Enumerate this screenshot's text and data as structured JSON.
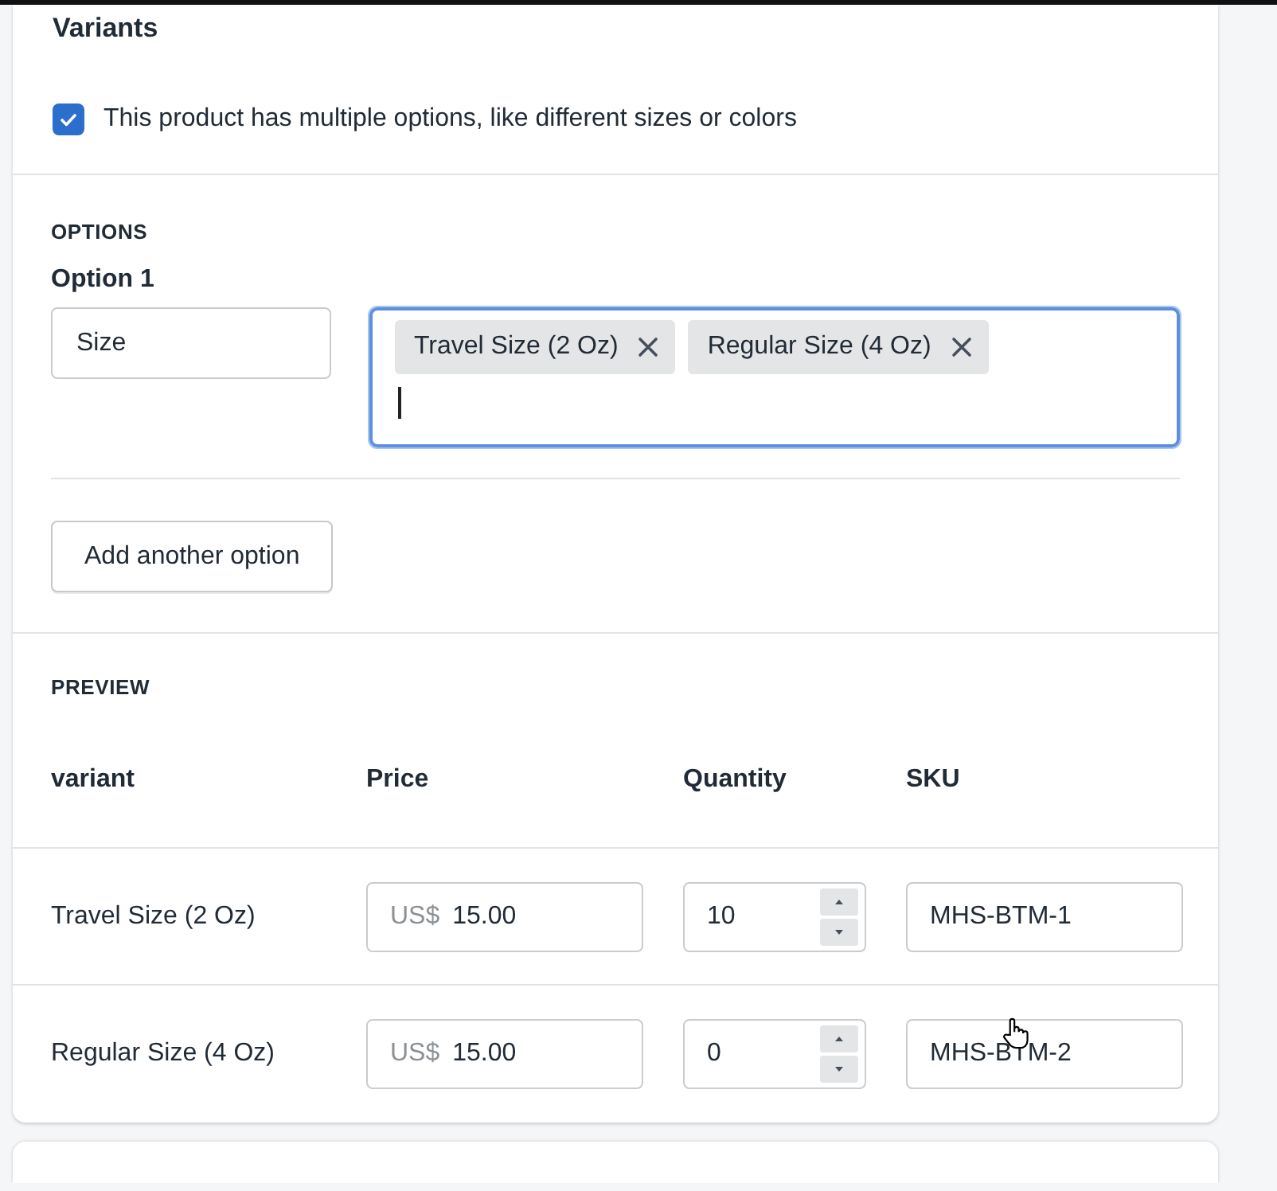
{
  "section": {
    "title": "Variants"
  },
  "multiple_options": {
    "label": "This product has multiple options, like different sizes or colors",
    "checked": true
  },
  "options": {
    "heading": "OPTIONS",
    "items": [
      {
        "label": "Option 1",
        "name": "Size",
        "focused": true,
        "values": [
          {
            "label": "Travel Size (2 Oz)"
          },
          {
            "label": "Regular Size (4 Oz)"
          }
        ]
      }
    ]
  },
  "add_option_button": "Add another option",
  "preview": {
    "heading": "PREVIEW",
    "columns": [
      "variant",
      "Price",
      "Quantity",
      "SKU"
    ],
    "rows": [
      {
        "variant": "Travel Size (2 Oz)",
        "currency": "US$",
        "price": "15.00",
        "quantity": "10",
        "sku": "MHS-BTM-1"
      },
      {
        "variant": "Regular Size (4 Oz)",
        "currency": "US$",
        "price": "15.00",
        "quantity": "0",
        "sku": "MHS-BTM-2"
      }
    ]
  }
}
